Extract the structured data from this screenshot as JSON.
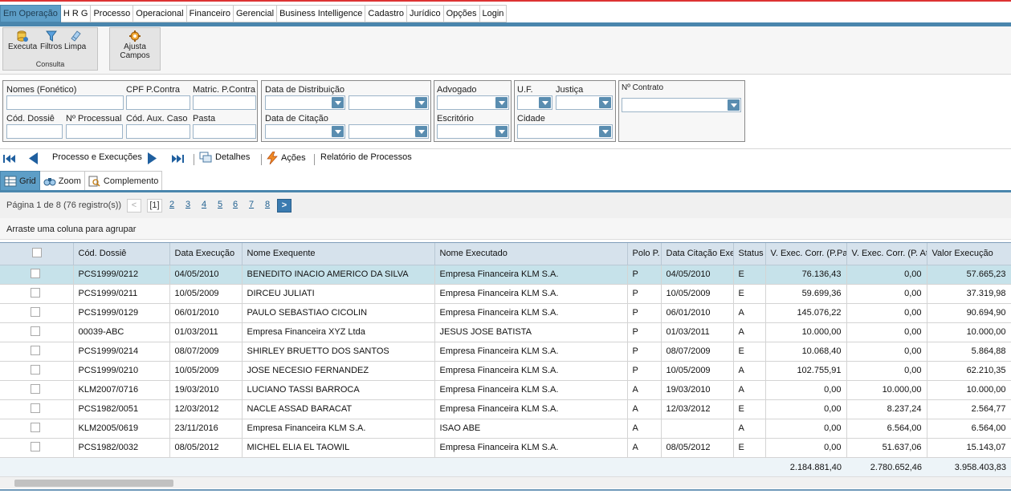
{
  "menu": [
    "Em Operação",
    "H R G",
    "Processo",
    "Operacional",
    "Financeiro",
    "Gerencial",
    "Business Intelligence",
    "Cadastro",
    "Jurídico",
    "Opções",
    "Login"
  ],
  "ribbon": {
    "executa": "Executa",
    "filtros": "Filtros",
    "limpa": "Limpa",
    "consulta": "Consulta",
    "ajusta": "Ajusta Campos"
  },
  "filters": {
    "nomes": "Nomes (Fonético)",
    "cpf": "CPF P.Contra",
    "matric": "Matric. P.Contra",
    "cod_dossie": "Cód. Dossiê",
    "n_processual": "Nº Processual",
    "cod_aux": "Cód. Aux. Caso",
    "pasta": "Pasta",
    "data_distribuicao": "Data de Distribuição",
    "data_citacao": "Data de Citação",
    "advogado": "Advogado",
    "escritorio": "Escritório",
    "uf": "U.F.",
    "justica": "Justiça",
    "cidade": "Cidade",
    "n_contrato": "Nº Contrato"
  },
  "nav": {
    "processo_execucoes": "Processo e Execuções",
    "detalhes": "Detalhes",
    "acoes": "Ações",
    "relatorio": "Relatório de Processos"
  },
  "viewtabs": {
    "grid": "Grid",
    "zoom": "Zoom",
    "complemento": "Complemento"
  },
  "pager": {
    "info": "Página 1 de 8 (76 registro(s))",
    "current": "[1]",
    "pages": [
      "2",
      "3",
      "4",
      "5",
      "6",
      "7",
      "8"
    ]
  },
  "groupbar": "Arraste uma coluna para agrupar",
  "columns": [
    "Cód. Dossiê",
    "Data Execução",
    "Nome Exequente",
    "Nome Executado",
    "Polo P.",
    "Data Citação Exec",
    "Status E",
    "V. Exec. Corr. (P.Pa",
    "V. Exec. Corr. (P. At",
    "Valor Execução"
  ],
  "rows": [
    [
      "PCS1999/0212",
      "04/05/2010",
      "BENEDITO INACIO AMERICO DA SILVA",
      "Empresa Financeira KLM S.A.",
      "P",
      "04/05/2010",
      "E",
      "76.136,43",
      "0,00",
      "57.665,23"
    ],
    [
      "PCS1999/0211",
      "10/05/2009",
      "DIRCEU JULIATI",
      "Empresa Financeira KLM S.A.",
      "P",
      "10/05/2009",
      "E",
      "59.699,36",
      "0,00",
      "37.319,98"
    ],
    [
      "PCS1999/0129",
      "06/01/2010",
      "PAULO SEBASTIAO CICOLIN",
      "Empresa Financeira KLM S.A.",
      "P",
      "06/01/2010",
      "A",
      "145.076,22",
      "0,00",
      "90.694,90"
    ],
    [
      "00039-ABC",
      "01/03/2011",
      "Empresa Financeira XYZ Ltda",
      "JESUS JOSE BATISTA",
      "P",
      "01/03/2011",
      "A",
      "10.000,00",
      "0,00",
      "10.000,00"
    ],
    [
      "PCS1999/0214",
      "08/07/2009",
      "SHIRLEY BRUETTO DOS SANTOS",
      "Empresa Financeira KLM S.A.",
      "P",
      "08/07/2009",
      "E",
      "10.068,40",
      "0,00",
      "5.864,88"
    ],
    [
      "PCS1999/0210",
      "10/05/2009",
      "JOSE NECESIO FERNANDEZ",
      "Empresa Financeira KLM S.A.",
      "P",
      "10/05/2009",
      "A",
      "102.755,91",
      "0,00",
      "62.210,35"
    ],
    [
      "KLM2007/0716",
      "19/03/2010",
      "LUCIANO TASSI BARROCA",
      "Empresa Financeira KLM S.A.",
      "A",
      "19/03/2010",
      "A",
      "0,00",
      "10.000,00",
      "10.000,00"
    ],
    [
      "PCS1982/0051",
      "12/03/2012",
      "NACLE ASSAD BARACAT",
      "Empresa Financeira KLM S.A.",
      "A",
      "12/03/2012",
      "E",
      "0,00",
      "8.237,24",
      "2.564,77"
    ],
    [
      "KLM2005/0619",
      "23/11/2016",
      "Empresa Financeira KLM S.A.",
      "ISAO ABE",
      "A",
      "",
      "A",
      "0,00",
      "6.564,00",
      "6.564,00"
    ],
    [
      "PCS1982/0032",
      "08/05/2012",
      "MICHEL ELIA EL TAOWIL",
      "Empresa Financeira KLM S.A.",
      "A",
      "08/05/2012",
      "E",
      "0,00",
      "51.637,06",
      "15.143,07"
    ]
  ],
  "totals": [
    "2.184.881,40",
    "2.780.652,46",
    "3.958.403,83"
  ],
  "colors": {
    "accent": "#5d9ec7",
    "selected_row": "#c6e2ea",
    "top_line": "#dd3333"
  }
}
